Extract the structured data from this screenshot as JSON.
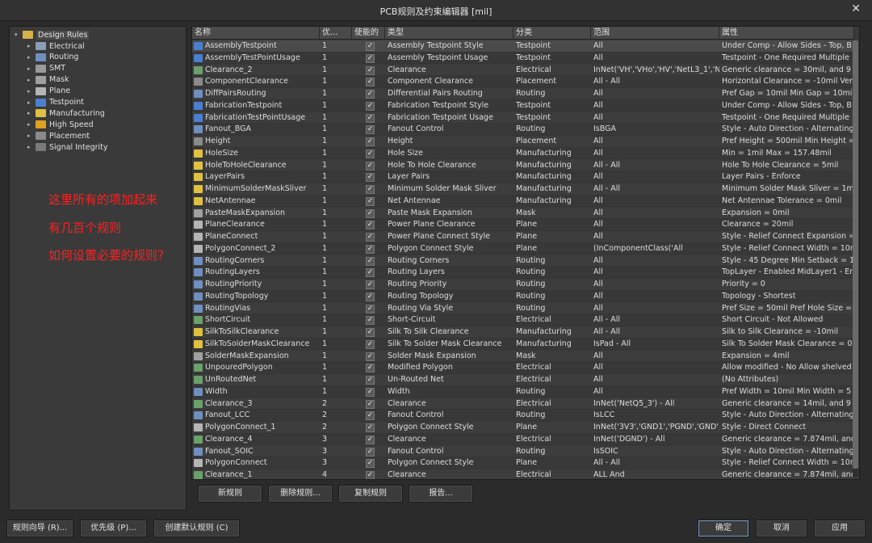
{
  "window": {
    "title": "PCB规则及约束编辑器 [mil]",
    "close_glyph": "✕"
  },
  "tree": {
    "root": "Design Rules",
    "items": [
      {
        "label": "Electrical",
        "icon": "electrical-icon",
        "color": "#8a9fb5"
      },
      {
        "label": "Routing",
        "icon": "routing-icon",
        "color": "#6f8fbf"
      },
      {
        "label": "SMT",
        "icon": "smt-icon",
        "color": "#9a9a9a"
      },
      {
        "label": "Mask",
        "icon": "mask-icon",
        "color": "#a0a0a0"
      },
      {
        "label": "Plane",
        "icon": "plane-icon",
        "color": "#b5b5b5"
      },
      {
        "label": "Testpoint",
        "icon": "testpoint-icon",
        "color": "#4a7fd0"
      },
      {
        "label": "Manufacturing",
        "icon": "manufacturing-icon",
        "color": "#e0c040"
      },
      {
        "label": "High Speed",
        "icon": "high-speed-icon",
        "color": "#e0a020"
      },
      {
        "label": "Placement",
        "icon": "placement-icon",
        "color": "#8a8a8a"
      },
      {
        "label": "Signal Integrity",
        "icon": "signal-integrity-icon",
        "color": "#7a7a7a"
      }
    ]
  },
  "annotation": {
    "line1": "这里所有的项加起来",
    "line2": "有几百个规则",
    "line3": "如何设置必要的规则？"
  },
  "table": {
    "headers": {
      "name": "名称",
      "priority": "优...",
      "enabled": "使能的",
      "type": "类型",
      "category": "分类",
      "scope": "范围",
      "attributes": "属性"
    },
    "check_glyph": "✓",
    "rows": [
      {
        "name": "AssemblyTestpoint",
        "priority": "1",
        "type": "Assembly Testpoint Style",
        "category": "Testpoint",
        "scope": "All",
        "attributes": "Under Comp - Allow    Sides - Top, B",
        "icon_color": "#4a7fd0"
      },
      {
        "name": "AssemblyTestPointUsage",
        "priority": "1",
        "type": "Assembly Testpoint Usage",
        "category": "Testpoint",
        "scope": "All",
        "attributes": "Testpoint - One Required    Multiple",
        "icon_color": "#4a7fd0"
      },
      {
        "name": "Clearance_2",
        "priority": "1",
        "type": "Clearance",
        "category": "Electrical",
        "scope": "InNet('VH','VHo','HV','NetL3_1','Net",
        "attributes": "Generic clearance = 30mil, and 9 va",
        "icon_color": "#6aa06a"
      },
      {
        "name": "ComponentClearance",
        "priority": "1",
        "type": "Component Clearance",
        "category": "Placement",
        "scope": "All   -   All",
        "attributes": "Horizontal Clearance = -10mil    Ver",
        "icon_color": "#8a8a8a"
      },
      {
        "name": "DiffPairsRouting",
        "priority": "1",
        "type": "Differential Pairs Routing",
        "category": "Routing",
        "scope": "All",
        "attributes": "Pref Gap = 10mil    Min Gap = 10mi",
        "icon_color": "#6f8fbf"
      },
      {
        "name": "FabricationTestpoint",
        "priority": "1",
        "type": "Fabrication Testpoint Style",
        "category": "Testpoint",
        "scope": "All",
        "attributes": "Under Comp - Allow    Sides - Top, B",
        "icon_color": "#4a7fd0"
      },
      {
        "name": "FabricationTestPointUsage",
        "priority": "1",
        "type": "Fabrication Testpoint Usage",
        "category": "Testpoint",
        "scope": "All",
        "attributes": "Testpoint - One Required    Multiple",
        "icon_color": "#4a7fd0"
      },
      {
        "name": "Fanout_BGA",
        "priority": "1",
        "type": "Fanout Control",
        "category": "Routing",
        "scope": "IsBGA",
        "attributes": "Style - Auto    Direction - Alternating",
        "icon_color": "#6f8fbf"
      },
      {
        "name": "Height",
        "priority": "1",
        "type": "Height",
        "category": "Placement",
        "scope": "All",
        "attributes": "Pref Height = 500mil    Min Height =",
        "icon_color": "#8a8a8a"
      },
      {
        "name": "HoleSize",
        "priority": "1",
        "type": "Hole Size",
        "category": "Manufacturing",
        "scope": "All",
        "attributes": "Min = 1mil    Max = 157.48mil",
        "icon_color": "#e0c040"
      },
      {
        "name": "HoleToHoleClearance",
        "priority": "1",
        "type": "Hole To Hole Clearance",
        "category": "Manufacturing",
        "scope": "All   -   All",
        "attributes": "Hole To Hole Clearance = 5mil",
        "icon_color": "#e0c040"
      },
      {
        "name": "LayerPairs",
        "priority": "1",
        "type": "Layer Pairs",
        "category": "Manufacturing",
        "scope": "All",
        "attributes": "Layer Pairs - Enforce",
        "icon_color": "#e0c040"
      },
      {
        "name": "MinimumSolderMaskSliver",
        "priority": "1",
        "type": "Minimum Solder Mask Sliver",
        "category": "Manufacturing",
        "scope": "All   -   All",
        "attributes": "Minimum Solder Mask Sliver = 1mil",
        "icon_color": "#e0c040"
      },
      {
        "name": "NetAntennae",
        "priority": "1",
        "type": "Net Antennae",
        "category": "Manufacturing",
        "scope": "All",
        "attributes": "Net Antennae Tolerance = 0mil",
        "icon_color": "#e0c040"
      },
      {
        "name": "PasteMaskExpansion",
        "priority": "1",
        "type": "Paste Mask Expansion",
        "category": "Mask",
        "scope": "All",
        "attributes": "Expansion = 0mil",
        "icon_color": "#a0a0a0"
      },
      {
        "name": "PlaneClearance",
        "priority": "1",
        "type": "Power Plane Clearance",
        "category": "Plane",
        "scope": "All",
        "attributes": "Clearance = 20mil",
        "icon_color": "#b5b5b5"
      },
      {
        "name": "PlaneConnect",
        "priority": "1",
        "type": "Power Plane Connect Style",
        "category": "Plane",
        "scope": "All",
        "attributes": "Style - Relief Connect    Expansion =",
        "icon_color": "#b5b5b5"
      },
      {
        "name": "PolygonConnect_2",
        "priority": "1",
        "type": "Polygon Connect Style",
        "category": "Plane",
        "scope": "(InComponentClass('All",
        "attributes": "Style - Relief Connect    Width = 10m",
        "icon_color": "#b5b5b5"
      },
      {
        "name": "RoutingCorners",
        "priority": "1",
        "type": "Routing Corners",
        "category": "Routing",
        "scope": "All",
        "attributes": "Style - 45 Degree    Min Setback = 1",
        "icon_color": "#6f8fbf"
      },
      {
        "name": "RoutingLayers",
        "priority": "1",
        "type": "Routing Layers",
        "category": "Routing",
        "scope": "All",
        "attributes": "TopLayer - Enabled MidLayer1 - Ena",
        "icon_color": "#6f8fbf"
      },
      {
        "name": "RoutingPriority",
        "priority": "1",
        "type": "Routing Priority",
        "category": "Routing",
        "scope": "All",
        "attributes": "Priority = 0",
        "icon_color": "#6f8fbf"
      },
      {
        "name": "RoutingTopology",
        "priority": "1",
        "type": "Routing Topology",
        "category": "Routing",
        "scope": "All",
        "attributes": "Topology - Shortest",
        "icon_color": "#6f8fbf"
      },
      {
        "name": "RoutingVias",
        "priority": "1",
        "type": "Routing Via Style",
        "category": "Routing",
        "scope": "All",
        "attributes": "Pref Size = 50mil    Pref Hole Size =",
        "icon_color": "#6f8fbf"
      },
      {
        "name": "ShortCircuit",
        "priority": "1",
        "type": "Short-Circuit",
        "category": "Electrical",
        "scope": "All   -   All",
        "attributes": "Short Circuit - Not Allowed",
        "icon_color": "#6aa06a"
      },
      {
        "name": "SilkToSilkClearance",
        "priority": "1",
        "type": "Silk To Silk Clearance",
        "category": "Manufacturing",
        "scope": "All   -   All",
        "attributes": "Silk to Silk Clearance = -10mil",
        "icon_color": "#e0c040"
      },
      {
        "name": "SilkToSolderMaskClearance",
        "priority": "1",
        "type": "Silk To Solder Mask Clearance",
        "category": "Manufacturing",
        "scope": "IsPad   -   All",
        "attributes": "Silk To Solder Mask Clearance = 0m",
        "icon_color": "#e0c040"
      },
      {
        "name": "SolderMaskExpansion",
        "priority": "1",
        "type": "Solder Mask Expansion",
        "category": "Mask",
        "scope": "All",
        "attributes": "Expansion = 4mil",
        "icon_color": "#a0a0a0"
      },
      {
        "name": "UnpouredPolygon",
        "priority": "1",
        "type": "Modified Polygon",
        "category": "Electrical",
        "scope": "All",
        "attributes": "Allow modified - No    Allow shelved",
        "icon_color": "#6aa06a"
      },
      {
        "name": "UnRoutedNet",
        "priority": "1",
        "type": "Un-Routed Net",
        "category": "Electrical",
        "scope": "All",
        "attributes": "(No Attributes)",
        "icon_color": "#6aa06a"
      },
      {
        "name": "Width",
        "priority": "1",
        "type": "Width",
        "category": "Routing",
        "scope": "All",
        "attributes": "Pref Width = 10mil    Min Width = 5",
        "icon_color": "#6f8fbf"
      },
      {
        "name": "Clearance_3",
        "priority": "2",
        "type": "Clearance",
        "category": "Electrical",
        "scope": "InNet('NetQ5_3')   -   All",
        "attributes": "Generic clearance = 14mil, and 9 va",
        "icon_color": "#6aa06a"
      },
      {
        "name": "Fanout_LCC",
        "priority": "2",
        "type": "Fanout Control",
        "category": "Routing",
        "scope": "IsLCC",
        "attributes": "Style - Auto    Direction - Alternating",
        "icon_color": "#6f8fbf"
      },
      {
        "name": "PolygonConnect_1",
        "priority": "2",
        "type": "Polygon Connect Style",
        "category": "Plane",
        "scope": "InNet('3V3','GND1','PGND','GND','D",
        "attributes": "Style - Direct Connect",
        "icon_color": "#b5b5b5"
      },
      {
        "name": "Clearance_4",
        "priority": "3",
        "type": "Clearance",
        "category": "Electrical",
        "scope": "InNet('DGND')   -   All",
        "attributes": "Generic clearance = 7.874mil, and 9",
        "icon_color": "#6aa06a"
      },
      {
        "name": "Fanout_SOIC",
        "priority": "3",
        "type": "Fanout Control",
        "category": "Routing",
        "scope": "IsSOIC",
        "attributes": "Style - Auto    Direction - Alternating",
        "icon_color": "#6f8fbf"
      },
      {
        "name": "PolygonConnect",
        "priority": "3",
        "type": "Polygon Connect Style",
        "category": "Plane",
        "scope": "All   -   All",
        "attributes": "Style - Relief Connect    Width = 10m",
        "icon_color": "#b5b5b5"
      },
      {
        "name": "Clearance_1",
        "priority": "4",
        "type": "Clearance",
        "category": "Electrical",
        "scope": "ALL And",
        "attributes": "Generic clearance = 7.874mil, and 9",
        "icon_color": "#6aa06a"
      }
    ]
  },
  "grid_buttons": {
    "new_rule": "新规则",
    "delete_rule": "删除规则...",
    "copy_rule": "复制规则",
    "report": "报告..."
  },
  "footer": {
    "rule_wizard": "规则向导 (R)...",
    "priority": "优先级 (P)...",
    "create_default": "创建默认规则 (C)",
    "ok": "确定",
    "cancel": "取消",
    "apply": "应用"
  }
}
